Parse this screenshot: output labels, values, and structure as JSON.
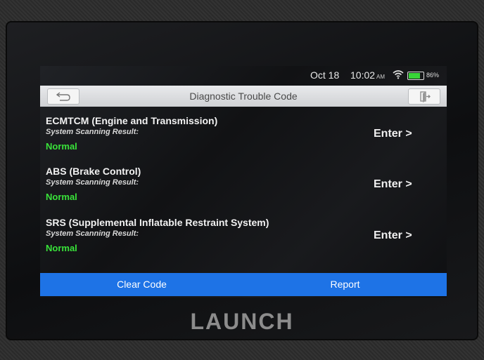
{
  "status": {
    "date": "Oct 18",
    "time": "10:02",
    "ampm": "AM",
    "battery": "86%"
  },
  "header": {
    "title": "Diagnostic Trouble Code"
  },
  "systems": [
    {
      "name": "ECMTCM (Engine and Transmission)",
      "result_label": "System Scanning Result:",
      "result": "Normal",
      "action": "Enter >"
    },
    {
      "name": "ABS (Brake Control)",
      "result_label": "System Scanning Result:",
      "result": "Normal",
      "action": "Enter >"
    },
    {
      "name": "SRS (Supplemental Inflatable Restraint System)",
      "result_label": "System Scanning Result:",
      "result": "Normal",
      "action": "Enter >"
    }
  ],
  "footer": {
    "clear_label": "Clear Code",
    "report_label": "Report"
  },
  "brand": "LAUNCH",
  "colors": {
    "accent": "#1e73e6",
    "status_ok": "#39e33a",
    "titlebar": "#dcdde0"
  },
  "icons": {
    "back": "back-arrow-icon",
    "exit": "exit-door-icon",
    "wifi": "wifi-icon",
    "battery": "battery-icon"
  }
}
